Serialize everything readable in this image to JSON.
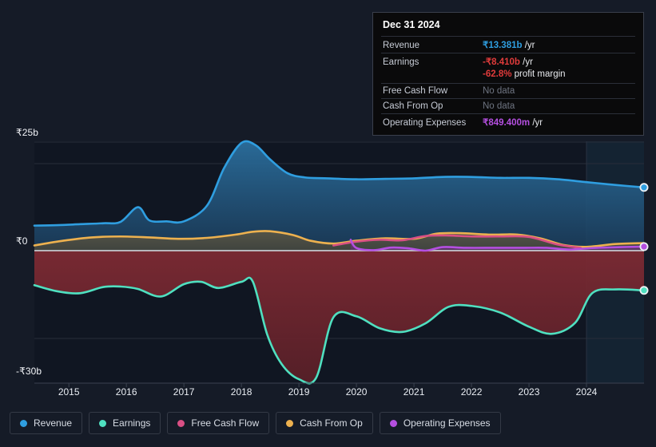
{
  "chart_data": {
    "type": "area",
    "title": "",
    "xlabel": "",
    "ylabel": "",
    "currency_symbol": "₹",
    "ylim": [
      -30,
      25
    ],
    "xlim": [
      2014.4,
      2025.0
    ],
    "grid": true,
    "legend_position": "bottom-left",
    "y_ticks": [
      {
        "value": 25,
        "label": "₹25b"
      },
      {
        "value": 0,
        "label": "₹0"
      },
      {
        "value": -30,
        "label": "-₹30b"
      }
    ],
    "x_ticks": [
      "2015",
      "2016",
      "2017",
      "2018",
      "2019",
      "2020",
      "2021",
      "2022",
      "2023",
      "2024"
    ],
    "forecast_band_start": 2024.0,
    "series": [
      {
        "name": "Revenue",
        "color": "#2f9ee0",
        "fill": "#1d4a6b",
        "x": [
          2014.4,
          2014.8,
          2015.2,
          2015.6,
          2015.9,
          2016.2,
          2016.4,
          2016.7,
          2017.0,
          2017.4,
          2017.7,
          2018.0,
          2018.25,
          2018.5,
          2018.8,
          2019.1,
          2019.5,
          2020.0,
          2020.5,
          2021.0,
          2021.5,
          2022.0,
          2022.5,
          2023.0,
          2023.5,
          2024.0,
          2024.5,
          2025.0
        ],
        "values": [
          5.3,
          5.4,
          5.6,
          5.8,
          6.1,
          9.2,
          6.4,
          6.2,
          6.2,
          9.5,
          17.5,
          22.8,
          22.3,
          19.3,
          16.4,
          15.5,
          15.3,
          15.1,
          15.2,
          15.3,
          15.6,
          15.6,
          15.4,
          15.4,
          15.1,
          14.5,
          13.9,
          13.381
        ]
      },
      {
        "name": "Earnings",
        "color": "#4fe0c0",
        "fill": "#6b2630",
        "x": [
          2014.4,
          2014.8,
          2015.2,
          2015.6,
          2015.9,
          2016.2,
          2016.6,
          2017.0,
          2017.3,
          2017.6,
          2018.0,
          2018.2,
          2018.45,
          2018.7,
          2019.0,
          2019.3,
          2019.6,
          2020.0,
          2020.4,
          2020.8,
          2021.2,
          2021.6,
          2022.0,
          2022.5,
          2023.0,
          2023.4,
          2023.8,
          2024.1,
          2024.5,
          2025.0
        ],
        "values": [
          -7.3,
          -8.6,
          -9.0,
          -7.7,
          -7.6,
          -8.1,
          -9.7,
          -7.1,
          -6.6,
          -7.9,
          -6.6,
          -6.6,
          -17.8,
          -24.0,
          -27.2,
          -26.9,
          -14.1,
          -13.9,
          -16.4,
          -17.2,
          -15.4,
          -11.9,
          -11.7,
          -13.1,
          -16.1,
          -17.6,
          -15.3,
          -9.0,
          -8.2,
          -8.41
        ]
      },
      {
        "name": "Free Cash Flow",
        "color": "#d94f84",
        "x": [
          2019.6,
          2020.0,
          2020.4,
          2020.8,
          2021.2,
          2021.6,
          2022.0,
          2022.5,
          2023.0,
          2023.5,
          2023.9
        ],
        "values": [
          1.1,
          1.9,
          2.3,
          2.2,
          3.1,
          3.2,
          3.0,
          3.0,
          2.9,
          1.3,
          0.6
        ]
      },
      {
        "name": "Cash From Op",
        "color": "#edb14f",
        "fill": "#4b4a40",
        "x": [
          2014.4,
          2014.9,
          2015.4,
          2015.9,
          2016.4,
          2016.9,
          2017.4,
          2017.9,
          2018.2,
          2018.5,
          2018.9,
          2019.2,
          2019.6,
          2020.0,
          2020.5,
          2021.0,
          2021.4,
          2021.8,
          2022.3,
          2022.8,
          2023.2,
          2023.6,
          2024.0,
          2024.5,
          2025.0
        ],
        "values": [
          1.1,
          2.1,
          2.8,
          3.0,
          2.8,
          2.5,
          2.7,
          3.4,
          4.0,
          4.1,
          3.3,
          2.1,
          1.5,
          2.1,
          2.6,
          2.5,
          3.6,
          3.7,
          3.4,
          3.4,
          2.6,
          1.2,
          0.8,
          1.4,
          1.6
        ]
      },
      {
        "name": "Operating Expenses",
        "color": "#b44fe0",
        "x": [
          2019.9,
          2020.0,
          2020.3,
          2020.6,
          2020.9,
          2021.2,
          2021.5,
          2021.9,
          2022.4,
          2022.9,
          2023.3,
          2023.7,
          2024.1,
          2024.6,
          2025.0
        ],
        "values": [
          2.3,
          0.55,
          0.1,
          0.65,
          0.5,
          0.0,
          0.75,
          0.6,
          0.6,
          0.6,
          0.6,
          0.25,
          0.55,
          0.75,
          0.849
        ]
      }
    ]
  },
  "tooltip": {
    "date": "Dec 31 2024",
    "rows": [
      {
        "key": "Revenue",
        "value": "₹13.381b",
        "unit": " /yr",
        "style": "revenue"
      },
      {
        "key": "Earnings",
        "value": "-₹8.410b",
        "unit": " /yr",
        "style": "earnings"
      },
      {
        "key": "",
        "value": "-62.8%",
        "unit": " profit margin",
        "style": "earnings",
        "sub": true
      },
      {
        "key": "Free Cash Flow",
        "value": "No data",
        "unit": "",
        "style": "nodata"
      },
      {
        "key": "Cash From Op",
        "value": "No data",
        "unit": "",
        "style": "nodata"
      },
      {
        "key": "Operating Expenses",
        "value": "₹849.400m",
        "unit": " /yr",
        "style": "opex"
      }
    ]
  },
  "legend": {
    "items": [
      {
        "label": "Revenue",
        "color": "#2f9ee0"
      },
      {
        "label": "Earnings",
        "color": "#4fe0c0"
      },
      {
        "label": "Free Cash Flow",
        "color": "#d94f84"
      },
      {
        "label": "Cash From Op",
        "color": "#edb14f"
      },
      {
        "label": "Operating Expenses",
        "color": "#b44fe0"
      }
    ]
  },
  "colors": {
    "background": "#151b27",
    "plot_background": "#101622",
    "zero_line": "#c9ccd2",
    "grid": "#272d3a"
  }
}
